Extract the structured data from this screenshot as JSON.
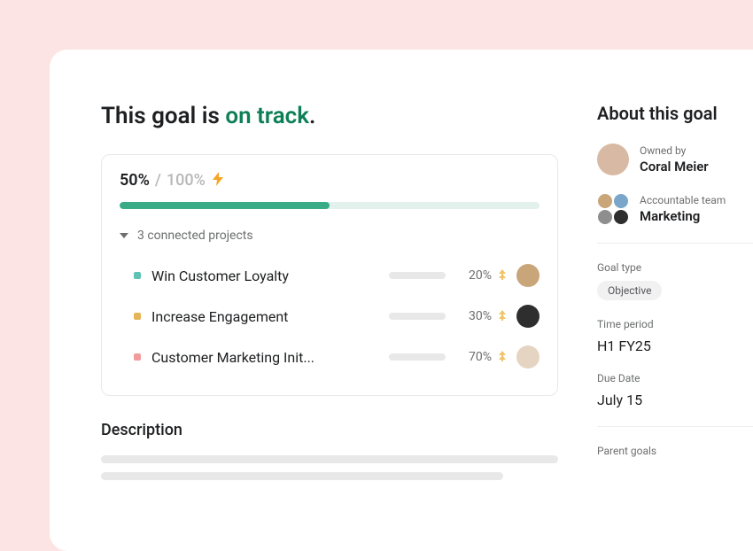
{
  "title": {
    "prefix": "This goal is ",
    "status": "on track",
    "suffix": "."
  },
  "progress": {
    "current_label": "50%",
    "separator": "/",
    "max_label": "100%",
    "percent": 50
  },
  "connected": {
    "label": "3 connected projects",
    "projects": [
      {
        "name": "Win Customer Loyalty",
        "percent_label": "20%",
        "percent": 20,
        "dot_color": "#5fc3b4",
        "avatar_bg": "#c9a57a"
      },
      {
        "name": "Increase Engagement",
        "percent_label": "30%",
        "percent": 30,
        "dot_color": "#e7b557",
        "avatar_bg": "#2e2e2e"
      },
      {
        "name": "Customer Marketing Init...",
        "percent_label": "70%",
        "percent": 70,
        "dot_color": "#f29b9b",
        "avatar_bg": "#e6d4c3"
      }
    ]
  },
  "description_heading": "Description",
  "sidebar": {
    "heading": "About this goal",
    "owner": {
      "label": "Owned by",
      "name": "Coral Meier",
      "avatar_bg": "#d8b9a3"
    },
    "team": {
      "label": "Accountable team",
      "name": "Marketing"
    },
    "goal_type": {
      "label": "Goal type",
      "value": "Objective"
    },
    "time_period": {
      "label": "Time period",
      "value": "H1 FY25"
    },
    "due_date": {
      "label": "Due Date",
      "value": "July 15"
    },
    "parent_goals": {
      "label": "Parent goals"
    }
  }
}
